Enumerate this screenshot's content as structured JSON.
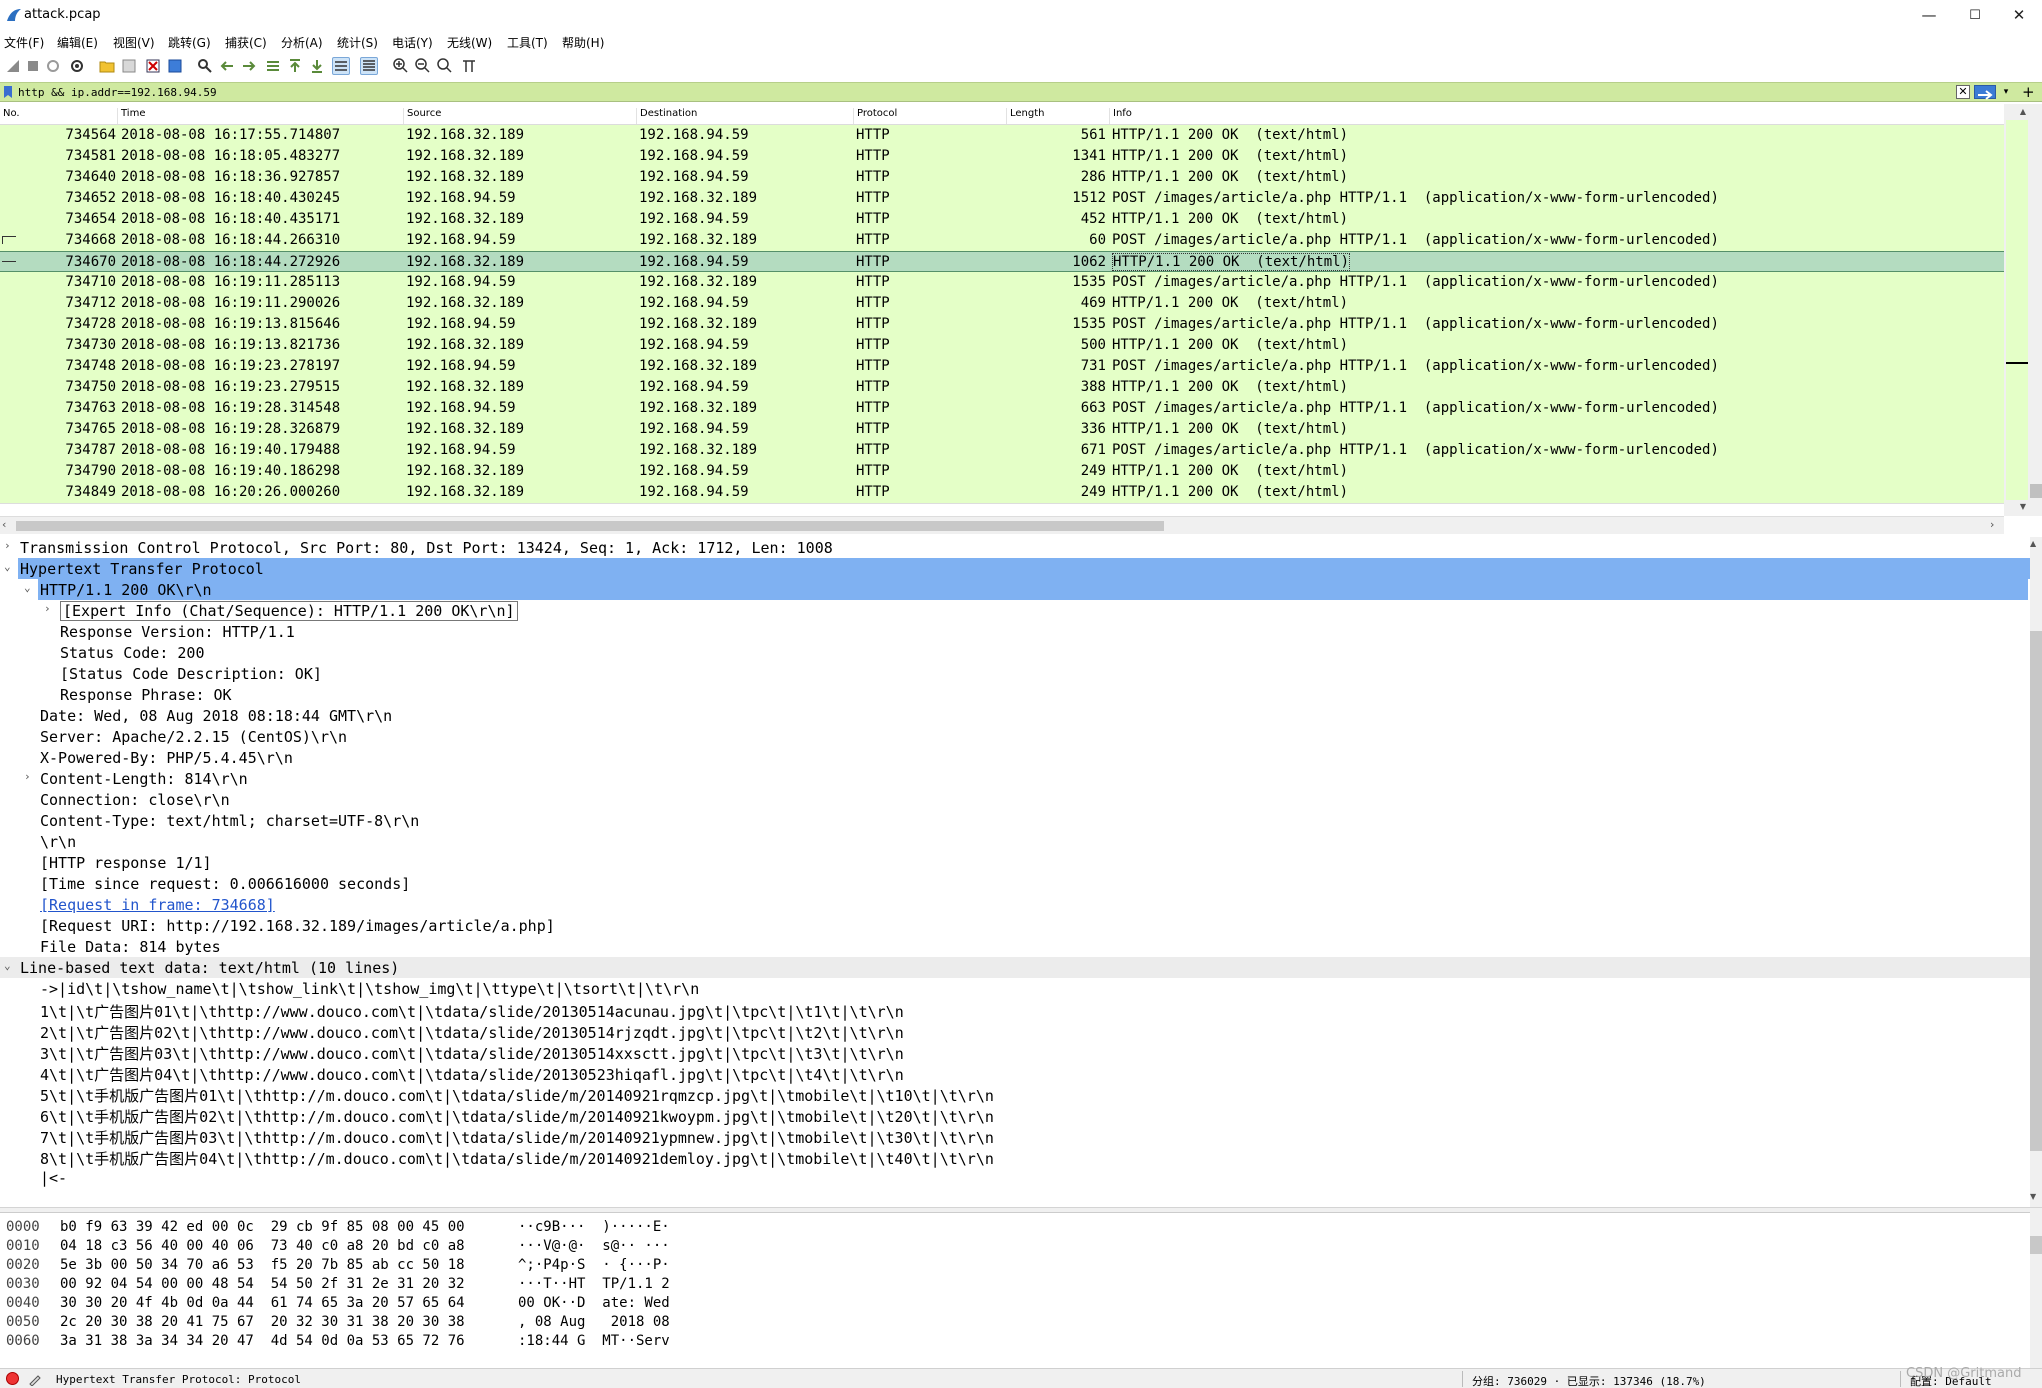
{
  "window": {
    "title": "attack.pcap",
    "minimize": "—",
    "maximize": "☐",
    "close": "✕"
  },
  "menu": [
    "文件(F)",
    "编辑(E)",
    "视图(V)",
    "跳转(G)",
    "捕获(C)",
    "分析(A)",
    "统计(S)",
    "电话(Y)",
    "无线(W)",
    "工具(T)",
    "帮助(H)"
  ],
  "filter": {
    "value": "http && ip.addr==192.168.94.59"
  },
  "columns": [
    "No.",
    "Time",
    "Source",
    "Destination",
    "Protocol",
    "Length",
    "Info"
  ],
  "packets": [
    {
      "no": "734564",
      "time": "2018-08-08 16:17:55.714807",
      "src": "192.168.32.189",
      "dst": "192.168.94.59",
      "proto": "HTTP",
      "len": "561",
      "info": "HTTP/1.1 200 OK  (text/html)"
    },
    {
      "no": "734581",
      "time": "2018-08-08 16:18:05.483277",
      "src": "192.168.32.189",
      "dst": "192.168.94.59",
      "proto": "HTTP",
      "len": "1341",
      "info": "HTTP/1.1 200 OK  (text/html)"
    },
    {
      "no": "734640",
      "time": "2018-08-08 16:18:36.927857",
      "src": "192.168.32.189",
      "dst": "192.168.94.59",
      "proto": "HTTP",
      "len": "286",
      "info": "HTTP/1.1 200 OK  (text/html)"
    },
    {
      "no": "734652",
      "time": "2018-08-08 16:18:40.430245",
      "src": "192.168.94.59",
      "dst": "192.168.32.189",
      "proto": "HTTP",
      "len": "1512",
      "info": "POST /images/article/a.php HTTP/1.1  (application/x-www-form-urlencoded)"
    },
    {
      "no": "734654",
      "time": "2018-08-08 16:18:40.435171",
      "src": "192.168.32.189",
      "dst": "192.168.94.59",
      "proto": "HTTP",
      "len": "452",
      "info": "HTTP/1.1 200 OK  (text/html)"
    },
    {
      "no": "734668",
      "time": "2018-08-08 16:18:44.266310",
      "src": "192.168.94.59",
      "dst": "192.168.32.189",
      "proto": "HTTP",
      "len": "60",
      "info": "POST /images/article/a.php HTTP/1.1  (application/x-www-form-urlencoded)"
    },
    {
      "no": "734670",
      "time": "2018-08-08 16:18:44.272926",
      "src": "192.168.32.189",
      "dst": "192.168.94.59",
      "proto": "HTTP",
      "len": "1062",
      "info": "HTTP/1.1 200 OK  (text/html)"
    },
    {
      "no": "734710",
      "time": "2018-08-08 16:19:11.285113",
      "src": "192.168.94.59",
      "dst": "192.168.32.189",
      "proto": "HTTP",
      "len": "1535",
      "info": "POST /images/article/a.php HTTP/1.1  (application/x-www-form-urlencoded)"
    },
    {
      "no": "734712",
      "time": "2018-08-08 16:19:11.290026",
      "src": "192.168.32.189",
      "dst": "192.168.94.59",
      "proto": "HTTP",
      "len": "469",
      "info": "HTTP/1.1 200 OK  (text/html)"
    },
    {
      "no": "734728",
      "time": "2018-08-08 16:19:13.815646",
      "src": "192.168.94.59",
      "dst": "192.168.32.189",
      "proto": "HTTP",
      "len": "1535",
      "info": "POST /images/article/a.php HTTP/1.1  (application/x-www-form-urlencoded)"
    },
    {
      "no": "734730",
      "time": "2018-08-08 16:19:13.821736",
      "src": "192.168.32.189",
      "dst": "192.168.94.59",
      "proto": "HTTP",
      "len": "500",
      "info": "HTTP/1.1 200 OK  (text/html)"
    },
    {
      "no": "734748",
      "time": "2018-08-08 16:19:23.278197",
      "src": "192.168.94.59",
      "dst": "192.168.32.189",
      "proto": "HTTP",
      "len": "731",
      "info": "POST /images/article/a.php HTTP/1.1  (application/x-www-form-urlencoded)"
    },
    {
      "no": "734750",
      "time": "2018-08-08 16:19:23.279515",
      "src": "192.168.32.189",
      "dst": "192.168.94.59",
      "proto": "HTTP",
      "len": "388",
      "info": "HTTP/1.1 200 OK  (text/html)"
    },
    {
      "no": "734763",
      "time": "2018-08-08 16:19:28.314548",
      "src": "192.168.94.59",
      "dst": "192.168.32.189",
      "proto": "HTTP",
      "len": "663",
      "info": "POST /images/article/a.php HTTP/1.1  (application/x-www-form-urlencoded)"
    },
    {
      "no": "734765",
      "time": "2018-08-08 16:19:28.326879",
      "src": "192.168.32.189",
      "dst": "192.168.94.59",
      "proto": "HTTP",
      "len": "336",
      "info": "HTTP/1.1 200 OK  (text/html)"
    },
    {
      "no": "734787",
      "time": "2018-08-08 16:19:40.179488",
      "src": "192.168.94.59",
      "dst": "192.168.32.189",
      "proto": "HTTP",
      "len": "671",
      "info": "POST /images/article/a.php HTTP/1.1  (application/x-www-form-urlencoded)"
    },
    {
      "no": "734790",
      "time": "2018-08-08 16:19:40.186298",
      "src": "192.168.32.189",
      "dst": "192.168.94.59",
      "proto": "HTTP",
      "len": "249",
      "info": "HTTP/1.1 200 OK  (text/html)"
    },
    {
      "no": "734849",
      "time": "2018-08-08 16:20:26.000260",
      "src": "192.168.32.189",
      "dst": "192.168.94.59",
      "proto": "HTTP",
      "len": "249",
      "info": "HTTP/1.1 200 OK  (text/html)"
    }
  ],
  "selected_packet": "734670",
  "details": [
    {
      "text": "Transmission Control Protocol, Src Port: 80, Dst Port: 13424, Seq: 1, Ack: 1712, Len: 1008",
      "indent": 0,
      "toggle": "collapsed"
    },
    {
      "text": "Hypertext Transfer Protocol",
      "indent": 0,
      "toggle": "expanded",
      "state": "selected"
    },
    {
      "text": "HTTP/1.1 200 OK\\r\\n",
      "indent": 1,
      "toggle": "expanded",
      "state": "highlighted"
    },
    {
      "text": "[Expert Info (Chat/Sequence): HTTP/1.1 200 OK\\r\\n]",
      "indent": 2,
      "toggle": "collapsed",
      "state": "boxed"
    },
    {
      "text": "Response Version: HTTP/1.1",
      "indent": 2
    },
    {
      "text": "Status Code: 200",
      "indent": 2
    },
    {
      "text": "[Status Code Description: OK]",
      "indent": 2
    },
    {
      "text": "Response Phrase: OK",
      "indent": 2
    },
    {
      "text": "Date: Wed, 08 Aug 2018 08:18:44 GMT\\r\\n",
      "indent": 1
    },
    {
      "text": "Server: Apache/2.2.15 (CentOS)\\r\\n",
      "indent": 1
    },
    {
      "text": "X-Powered-By: PHP/5.4.45\\r\\n",
      "indent": 1
    },
    {
      "text": "Content-Length: 814\\r\\n",
      "indent": 1,
      "toggle": "collapsed"
    },
    {
      "text": "Connection: close\\r\\n",
      "indent": 1
    },
    {
      "text": "Content-Type: text/html; charset=UTF-8\\r\\n",
      "indent": 1
    },
    {
      "text": "\\r\\n",
      "indent": 1
    },
    {
      "text": "[HTTP response 1/1]",
      "indent": 1
    },
    {
      "text": "[Time since request: 0.006616000 seconds]",
      "indent": 1
    },
    {
      "text": "[Request in frame: 734668]",
      "indent": 1,
      "link": true
    },
    {
      "text": "[Request URI: http://192.168.32.189/images/article/a.php]",
      "indent": 1
    },
    {
      "text": "File Data: 814 bytes",
      "indent": 1
    },
    {
      "text": "Line-based text data: text/html (10 lines)",
      "indent": 0,
      "toggle": "expanded",
      "state": "hover"
    },
    {
      "text": "->|id\\t|\\tshow_name\\t|\\tshow_link\\t|\\tshow_img\\t|\\ttype\\t|\\tsort\\t|\\t\\r\\n",
      "indent": 1
    },
    {
      "text": "1\\t|\\t广告图片01\\t|\\thttp://www.douco.com\\t|\\tdata/slide/20130514acunau.jpg\\t|\\tpc\\t|\\t1\\t|\\t\\r\\n",
      "indent": 1
    },
    {
      "text": "2\\t|\\t广告图片02\\t|\\thttp://www.douco.com\\t|\\tdata/slide/20130514rjzqdt.jpg\\t|\\tpc\\t|\\t2\\t|\\t\\r\\n",
      "indent": 1
    },
    {
      "text": "3\\t|\\t广告图片03\\t|\\thttp://www.douco.com\\t|\\tdata/slide/20130514xxsctt.jpg\\t|\\tpc\\t|\\t3\\t|\\t\\r\\n",
      "indent": 1
    },
    {
      "text": "4\\t|\\t广告图片04\\t|\\thttp://www.douco.com\\t|\\tdata/slide/20130523hiqafl.jpg\\t|\\tpc\\t|\\t4\\t|\\t\\r\\n",
      "indent": 1
    },
    {
      "text": "5\\t|\\t手机版广告图片01\\t|\\thttp://m.douco.com\\t|\\tdata/slide/m/20140921rqmzcp.jpg\\t|\\tmobile\\t|\\t10\\t|\\t\\r\\n",
      "indent": 1
    },
    {
      "text": "6\\t|\\t手机版广告图片02\\t|\\thttp://m.douco.com\\t|\\tdata/slide/m/20140921kwoypm.jpg\\t|\\tmobile\\t|\\t20\\t|\\t\\r\\n",
      "indent": 1
    },
    {
      "text": "7\\t|\\t手机版广告图片03\\t|\\thttp://m.douco.com\\t|\\tdata/slide/m/20140921ypmnew.jpg\\t|\\tmobile\\t|\\t30\\t|\\t\\r\\n",
      "indent": 1
    },
    {
      "text": "8\\t|\\t手机版广告图片04\\t|\\thttp://m.douco.com\\t|\\tdata/slide/m/20140921demloy.jpg\\t|\\tmobile\\t|\\t40\\t|\\t\\r\\n",
      "indent": 1
    },
    {
      "text": "|<-",
      "indent": 1
    }
  ],
  "hex": [
    {
      "offset": "0000",
      "bytes": "b0 f9 63 39 42 ed 00 0c  29 cb 9f 85 08 00 45 00",
      "ascii": "··c9B···  )·····E·"
    },
    {
      "offset": "0010",
      "bytes": "04 18 c3 56 40 00 40 06  73 40 c0 a8 20 bd c0 a8",
      "ascii": "···V@·@·  s@·· ···"
    },
    {
      "offset": "0020",
      "bytes": "5e 3b 00 50 34 70 a6 53  f5 20 7b 85 ab cc 50 18",
      "ascii": "^;·P4p·S  · {···P·"
    },
    {
      "offset": "0030",
      "bytes": "00 92 04 54 00 00 48 54  54 50 2f 31 2e 31 20 32",
      "ascii": "···T··HT  TP/1.1 2"
    },
    {
      "offset": "0040",
      "bytes": "30 30 20 4f 4b 0d 0a 44  61 74 65 3a 20 57 65 64",
      "ascii": "00 OK··D  ate: Wed"
    },
    {
      "offset": "0050",
      "bytes": "2c 20 30 38 20 41 75 67  20 32 30 31 38 20 30 38",
      "ascii": ", 08 Aug   2018 08"
    },
    {
      "offset": "0060",
      "bytes": "3a 31 38 3a 34 34 20 47  4d 54 0d 0a 53 65 72 76",
      "ascii": ":18:44 G  MT··Serv"
    }
  ],
  "status": {
    "left": "Hypertext Transfer Protocol: Protocol",
    "packets": "分组: 736029 · 已显示: 137346 (18.7%)",
    "profile": "配置: Default",
    "watermark": "CSDN @Gritmand"
  },
  "colors": {
    "row_bg": "#e4ffc7",
    "row_selected": "#b4dcc0",
    "detail_selected": "#7fb1f2",
    "filter_bg": "#cfe9a0",
    "link": "#2255cc"
  }
}
